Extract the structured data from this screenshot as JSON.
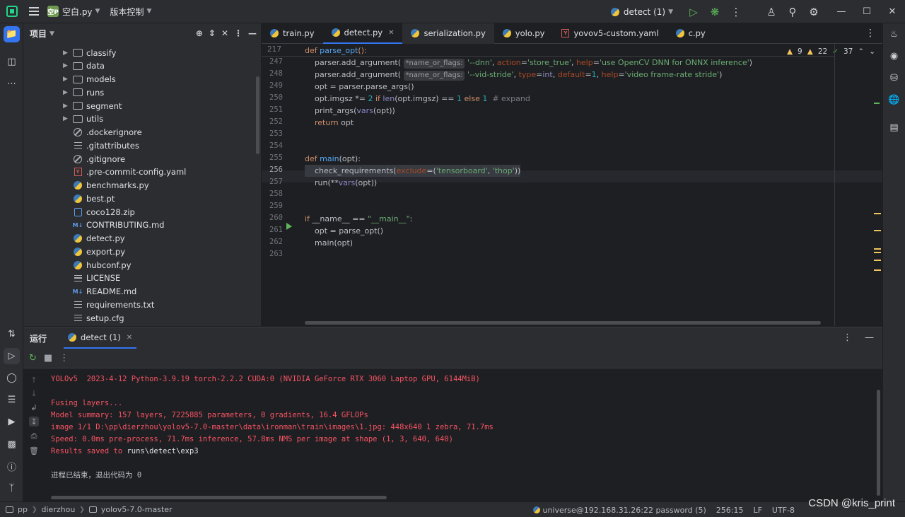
{
  "titlebar": {
    "project_badge": "空P",
    "project_name": "空白.py",
    "vcs_label": "版本控制",
    "run_config": "detect (1)"
  },
  "project_panel": {
    "title": "项目",
    "items": [
      {
        "label": "classify",
        "type": "folder"
      },
      {
        "label": "data",
        "type": "folder"
      },
      {
        "label": "models",
        "type": "folder"
      },
      {
        "label": "runs",
        "type": "folder"
      },
      {
        "label": "segment",
        "type": "folder"
      },
      {
        "label": "utils",
        "type": "folder"
      },
      {
        "label": ".dockerignore",
        "type": "ignore"
      },
      {
        "label": ".gitattributes",
        "type": "text"
      },
      {
        "label": ".gitignore",
        "type": "ignore"
      },
      {
        "label": ".pre-commit-config.yaml",
        "type": "yaml"
      },
      {
        "label": "benchmarks.py",
        "type": "py"
      },
      {
        "label": "best.pt",
        "type": "pt"
      },
      {
        "label": "coco128.zip",
        "type": "zip"
      },
      {
        "label": "CONTRIBUTING.md",
        "type": "md"
      },
      {
        "label": "detect.py",
        "type": "py"
      },
      {
        "label": "export.py",
        "type": "py"
      },
      {
        "label": "hubconf.py",
        "type": "py"
      },
      {
        "label": "LICENSE",
        "type": "text"
      },
      {
        "label": "README.md",
        "type": "md"
      },
      {
        "label": "requirements.txt",
        "type": "text"
      },
      {
        "label": "setup.cfg",
        "type": "text"
      }
    ]
  },
  "editor": {
    "tabs": [
      {
        "label": "train.py",
        "type": "py",
        "active": false
      },
      {
        "label": "detect.py",
        "type": "py",
        "active": true
      },
      {
        "label": "serialization.py",
        "type": "py",
        "active": false
      },
      {
        "label": "yolo.py",
        "type": "py",
        "active": false
      },
      {
        "label": "yovov5-custom.yaml",
        "type": "yaml",
        "active": false
      },
      {
        "label": "c.py",
        "type": "py",
        "active": false
      }
    ],
    "inspections": {
      "warnings": "9",
      "weak_warnings": "22",
      "ok": "37"
    },
    "sticky_line_number": "217",
    "sticky_line": "def parse_opt():",
    "line_numbers": [
      "247",
      "248",
      "249",
      "250",
      "251",
      "252",
      "253",
      "254",
      "255",
      "256",
      "257",
      "258",
      "259",
      "260",
      "261",
      "262",
      "263"
    ],
    "current_line": "256",
    "hint_label": "*name_or_flags:"
  },
  "run_panel": {
    "title": "运行",
    "tab_label": "detect (1)",
    "console_lines": [
      "YOLOv5  2023-4-12 Python-3.9.19 torch-2.2.2 CUDA:0 (NVIDIA GeForce RTX 3060 Laptop GPU, 6144MiB)",
      "",
      "Fusing layers...",
      "Model summary: 157 layers, 7225885 parameters, 0 gradients, 16.4 GFLOPs",
      "image 1/1 D:\\pp\\dierzhou\\yolov5-7.0-master\\data\\ironman\\train\\images\\1.jpg: 448x640 1 zebra, 71.7ms",
      "Speed: 0.0ms pre-process, 71.7ms inference, 57.8ms NMS per image at shape (1, 3, 640, 640)",
      "Results saved to ",
      "",
      "进程已结束，退出代码为 0"
    ],
    "results_path": "runs\\detect\\exp3"
  },
  "statusbar": {
    "breadcrumbs": [
      "pp",
      "dierzhou",
      "yolov5-7.0-master"
    ],
    "interpreter": "universe@192.168.31.26:22 password (5)",
    "position": "256:15",
    "line_ending": "LF",
    "encoding": "UTF-8"
  },
  "watermark": "CSDN @kris_print"
}
